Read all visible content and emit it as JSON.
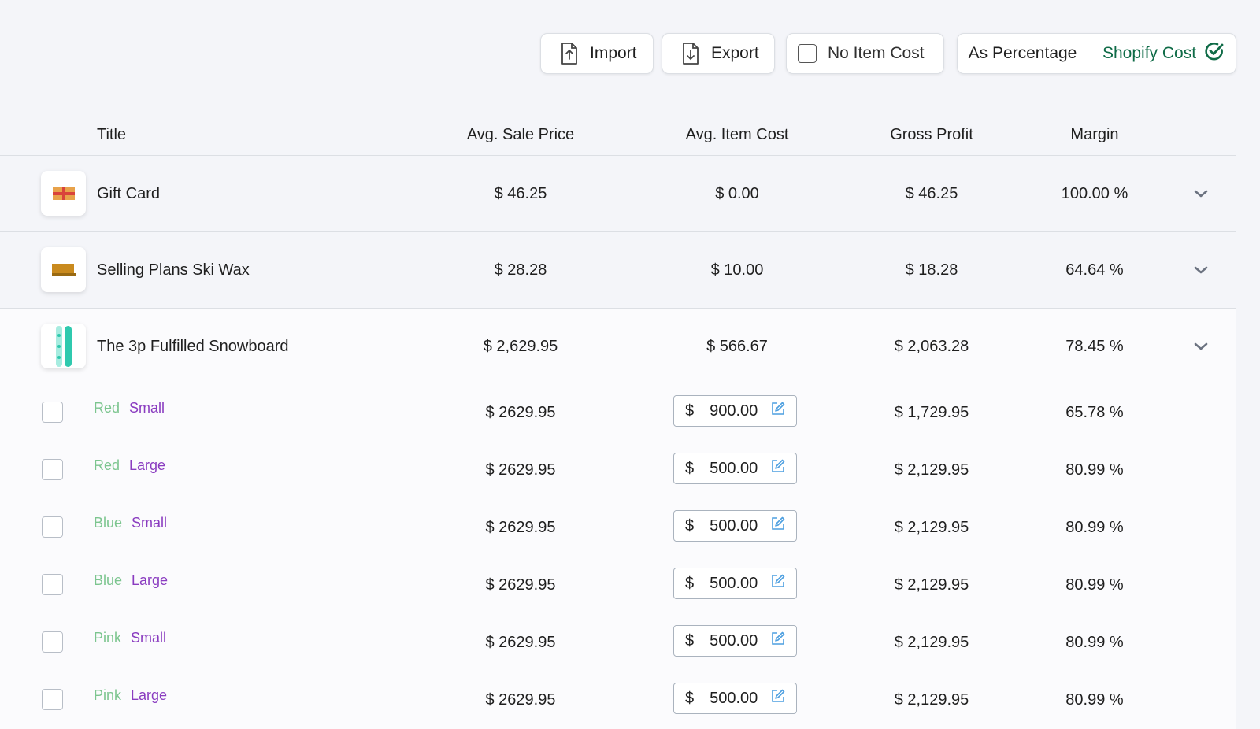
{
  "toolbar": {
    "import_label": "Import",
    "export_label": "Export",
    "no_item_cost_label": "No Item Cost",
    "as_percentage_label": "As Percentage",
    "shopify_cost_label": "Shopify Cost"
  },
  "colors": {
    "shopify_green": "#0f6b47",
    "variant_color_text": "#7cc58f",
    "variant_size_text": "#8a3cc0",
    "edit_icon": "#4d9fe0"
  },
  "table": {
    "headers": {
      "title": "Title",
      "avg_sale_price": "Avg. Sale Price",
      "avg_item_cost": "Avg. Item Cost",
      "gross_profit": "Gross Profit",
      "margin": "Margin"
    },
    "products": [
      {
        "title": "Gift Card",
        "sale": "$ 46.25",
        "cost": "$ 0.00",
        "gross": "$ 46.25",
        "margin": "100.00 %",
        "icon": "gift-card-icon"
      },
      {
        "title": "Selling Plans Ski Wax",
        "sale": "$ 28.28",
        "cost": "$ 10.00",
        "gross": "$ 18.28",
        "margin": "64.64 %",
        "icon": "ski-wax-icon"
      },
      {
        "title": "The 3p Fulfilled Snowboard",
        "sale": "$ 2,629.95",
        "cost": "$ 566.67",
        "gross": "$ 2,063.28",
        "margin": "78.45 %",
        "icon": "snowboard-icon"
      }
    ],
    "variants": [
      {
        "color": "Red",
        "size": "Small",
        "sale": "$ 2629.95",
        "currency": "$",
        "cost": "900.00",
        "gross": "$ 1,729.95",
        "margin": "65.78 %"
      },
      {
        "color": "Red",
        "size": "Large",
        "sale": "$ 2629.95",
        "currency": "$",
        "cost": "500.00",
        "gross": "$ 2,129.95",
        "margin": "80.99 %"
      },
      {
        "color": "Blue",
        "size": "Small",
        "sale": "$ 2629.95",
        "currency": "$",
        "cost": "500.00",
        "gross": "$ 2,129.95",
        "margin": "80.99 %"
      },
      {
        "color": "Blue",
        "size": "Large",
        "sale": "$ 2629.95",
        "currency": "$",
        "cost": "500.00",
        "gross": "$ 2,129.95",
        "margin": "80.99 %"
      },
      {
        "color": "Pink",
        "size": "Small",
        "sale": "$ 2629.95",
        "currency": "$",
        "cost": "500.00",
        "gross": "$ 2,129.95",
        "margin": "80.99 %"
      },
      {
        "color": "Pink",
        "size": "Large",
        "sale": "$ 2629.95",
        "currency": "$",
        "cost": "500.00",
        "gross": "$ 2,129.95",
        "margin": "80.99 %"
      }
    ]
  }
}
